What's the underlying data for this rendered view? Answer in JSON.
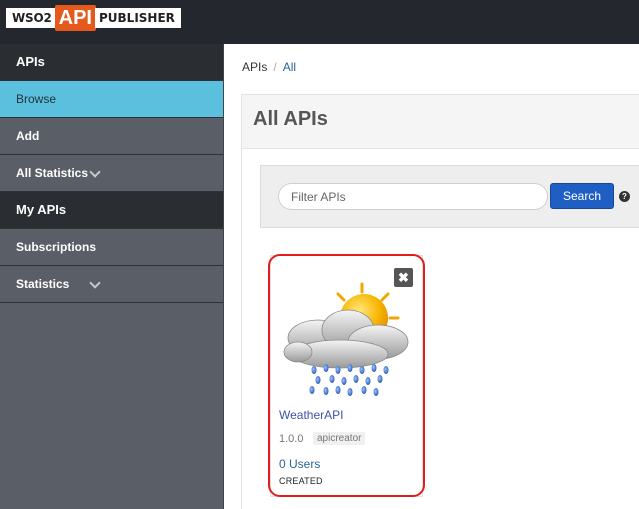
{
  "header": {
    "logo_wso2": "WSO2",
    "logo_api": "API",
    "logo_publisher": "PUBLISHER"
  },
  "sidebar": {
    "sections": [
      {
        "title": "APIs",
        "items": [
          {
            "label": "Browse",
            "active": true
          },
          {
            "label": "Add"
          },
          {
            "label": "All Statistics",
            "has_chevron": true
          }
        ]
      },
      {
        "title": "My APIs",
        "items": [
          {
            "label": "Subscriptions"
          },
          {
            "label": "Statistics",
            "has_chevron": true
          }
        ]
      }
    ]
  },
  "breadcrumb": {
    "root": "APIs",
    "separator": "/",
    "current": "All"
  },
  "main": {
    "title": "All APIs",
    "filter_placeholder": "Filter APIs",
    "search_label": "Search",
    "help_glyph": "?"
  },
  "api_cards": [
    {
      "name": "WeatherAPI",
      "version": "1.0.0",
      "provider": "apicreator",
      "users": "0 Users",
      "status": "CREATED",
      "icon": "weather-rain-cloud-sun-icon",
      "delete_glyph": "✖"
    }
  ],
  "colors": {
    "topbar": "#24282e",
    "sidebar": "#5a5f67",
    "sidebar_header": "#2a2e33",
    "active_item": "#5bc0de",
    "logo_accent": "#e55a1c",
    "search_button": "#1f5fc4",
    "highlight": "#e21d1d"
  }
}
